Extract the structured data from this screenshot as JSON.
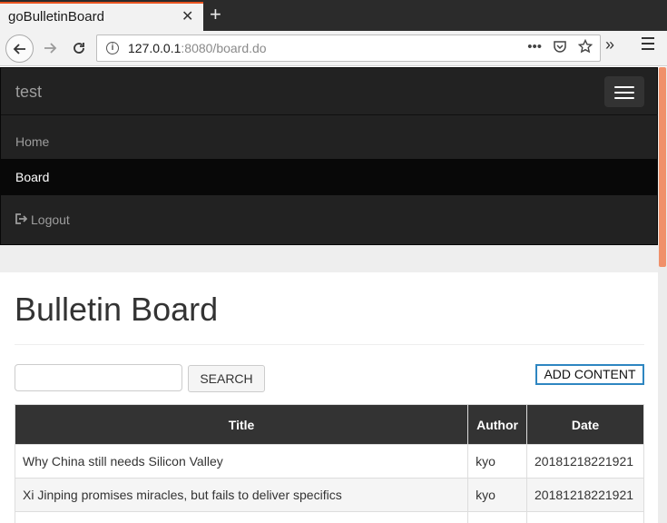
{
  "browser": {
    "tab_title": "goBulletinBoard",
    "tab_close": "✕",
    "new_tab": "+",
    "url_host": "127.0.0.1",
    "url_rest": ":8080/board.do",
    "icons": [
      "back-icon",
      "forward-icon",
      "reload-icon",
      "info-icon",
      "page-actions-icon",
      "pocket-icon",
      "bookmark-star-icon",
      "overflow-icon",
      "hamburger-menu-icon"
    ]
  },
  "site": {
    "brand": "test",
    "menu": {
      "home": "Home",
      "board": "Board",
      "logout": "Logout"
    }
  },
  "main": {
    "title": "Bulletin Board",
    "search_placeholder": "",
    "search_button": "SEARCH",
    "add_button": "ADD CONTENT",
    "table": {
      "headers": [
        "Title",
        "Author",
        "Date"
      ],
      "rows": [
        [
          "Why China still needs Silicon Valley",
          "kyo",
          "20181218221921"
        ],
        [
          "Xi Jinping promises miracles, but fails to deliver specifics",
          "kyo",
          "20181218221921"
        ],
        [
          "",
          "",
          ""
        ]
      ]
    }
  },
  "colors": {
    "accent_tab": "#e95420",
    "navbar_bg": "#222222",
    "active_item_bg": "#080808",
    "add_button_border": "#2e86c1",
    "table_header_bg": "#333333"
  }
}
